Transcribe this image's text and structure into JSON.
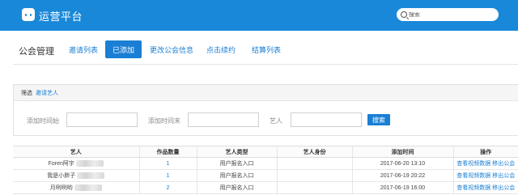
{
  "app": {
    "brand": "运营平台"
  },
  "search": {
    "placeholder": "搜索"
  },
  "page": {
    "title": "公会管理"
  },
  "tabs": [
    {
      "label": "邀请列表",
      "active": false
    },
    {
      "label": "已添加",
      "active": true
    },
    {
      "label": "更改公会信息",
      "active": false
    },
    {
      "label": "点击续约",
      "active": false
    },
    {
      "label": "结算列表",
      "active": false
    }
  ],
  "filter": {
    "label": "筛选",
    "link": "邀请艺人",
    "start_label": "添加时间始",
    "end_label": "添加时间末",
    "artist_label": "艺人",
    "start_value": "",
    "end_value": "",
    "artist_value": "",
    "search_button": "搜索"
  },
  "table": {
    "headers": [
      "艺人",
      "作品数量",
      "艺人类型",
      "艺人身份",
      "添加时间",
      "操作"
    ],
    "rows": [
      {
        "artist": "Foren阿宇",
        "works": "1",
        "type": "用户报名入口",
        "identity": "",
        "time": "2017-06-20 13:10",
        "action1": "查看视频数据",
        "action2": "移出公会"
      },
      {
        "artist": "我是小胖子",
        "works": "1",
        "type": "用户报名入口",
        "identity": "",
        "time": "2017-06-19 20:22",
        "action1": "查看视频数据",
        "action2": "移出公会"
      },
      {
        "artist": "月咧咧哟",
        "works": "2",
        "type": "用户报名入口",
        "identity": "",
        "time": "2017-06-19 16:00",
        "action1": "查看视频数据",
        "action2": "移出公会"
      }
    ]
  },
  "colors": {
    "brand_blue": "#1a88d8",
    "accent": "#1a7fd4"
  }
}
